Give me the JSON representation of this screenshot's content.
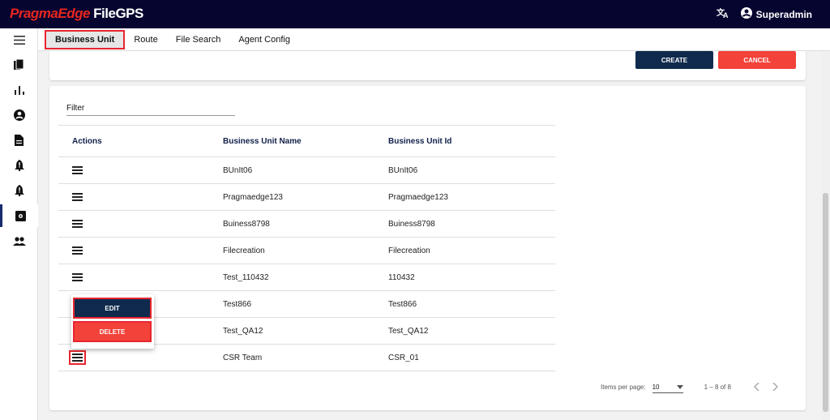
{
  "app": {
    "brand": "PragmaEdge",
    "product": " FileGPS"
  },
  "header": {
    "user_name": "Superadmin",
    "icons": [
      "translate-icon",
      "account-circle-icon"
    ]
  },
  "sidebar": {
    "items": [
      {
        "icon": "hamburger-menu-icon"
      },
      {
        "icon": "copy-files-icon"
      },
      {
        "icon": "bar-chart-icon"
      },
      {
        "icon": "account-icon"
      },
      {
        "icon": "document-icon"
      },
      {
        "icon": "bell-alert-icon"
      },
      {
        "icon": "bell-alert-icon"
      },
      {
        "icon": "settings-box-icon",
        "active": true
      },
      {
        "icon": "people-icon"
      }
    ]
  },
  "tabs": [
    {
      "label": "Business Unit",
      "active": true
    },
    {
      "label": "Route"
    },
    {
      "label": "File Search"
    },
    {
      "label": "Agent Config"
    }
  ],
  "actions": {
    "create_label": "CREATE",
    "cancel_label": "CANCEL"
  },
  "filter": {
    "label": "Filter"
  },
  "table": {
    "columns": [
      "Actions",
      "Business Unit Name",
      "Business Unit Id"
    ],
    "rows": [
      {
        "name": "BUnIt06",
        "id": "BUnIt06"
      },
      {
        "name": "Pragmaedge123",
        "id": "Pragmaedge123"
      },
      {
        "name": "Buiness8798",
        "id": "Buiness8798"
      },
      {
        "name": "Filecreation",
        "id": "Filecreation"
      },
      {
        "name": "Test_110432",
        "id": "110432"
      },
      {
        "name": "Test866",
        "id": "Test866"
      },
      {
        "name": "Test_QA12",
        "id": "Test_QA12"
      },
      {
        "name": "CSR Team",
        "id": "CSR_01"
      }
    ]
  },
  "row_menu": {
    "edit_label": "EDIT",
    "delete_label": "DELETE"
  },
  "paginator": {
    "items_per_page_label": "Items per page:",
    "page_size": "10",
    "range": "1 – 8 of 8"
  },
  "colors": {
    "topbar": "#050530",
    "brand": "#e8261f",
    "primary_button": "#0f2a4d",
    "danger_button": "#f2423a",
    "highlight": "#e8262f"
  }
}
